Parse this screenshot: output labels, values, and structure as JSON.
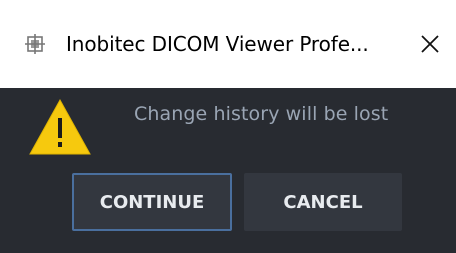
{
  "window": {
    "title": "Inobitec DICOM Viewer Profe..."
  },
  "icons": {
    "app": "inobitec-app-icon",
    "close": "close-icon",
    "warning": "warning-triangle-icon"
  },
  "dialog": {
    "message": "Change history will be lost",
    "continue_label": "CONTINUE",
    "cancel_label": "CANCEL"
  },
  "colors": {
    "body_background": "#282b31",
    "button_background": "#33373f",
    "focus_border": "#4a6f9e",
    "message_text": "#9aa5b4",
    "warning_yellow": "#f6c90e"
  }
}
